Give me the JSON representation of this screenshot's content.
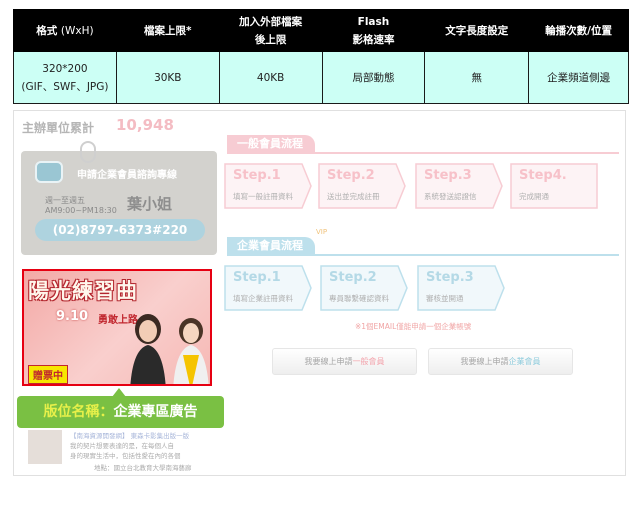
{
  "table": {
    "headers": [
      {
        "main": "格式",
        "sub": "(WxH)"
      },
      {
        "main": "檔案上限*",
        "sub": ""
      },
      {
        "main": "加入外部檔案",
        "main2": "後上限"
      },
      {
        "main": "Flash",
        "main2": "影格速率"
      },
      {
        "main": "文字長度設定",
        "sub": ""
      },
      {
        "main": "輪播次數/位置",
        "sub": ""
      }
    ],
    "row": {
      "format_size": "320*200",
      "format_types": "(GIF、SWF、JPG)",
      "file_limit": "30KB",
      "external_limit": "40KB",
      "flash_rate": "局部動態",
      "text_length": "無",
      "rotation": "企業頻道側邊"
    }
  },
  "preview": {
    "stat_label": "主辦單位累計",
    "stat_value": "10,948",
    "contact": {
      "title": "申請企業會員諮詢專線",
      "hours1": "週一至週五",
      "hours2": "AM9:00~PM18:30",
      "name": "葉小姐",
      "phone": "(02)8797-6373#220"
    },
    "ad": {
      "title": "陽光練習曲",
      "date": "9.10",
      "date_sub": "勇敢上路",
      "badge": "贈票中"
    },
    "placement_label": {
      "key": "版位名稱：",
      "value": "企業專區廣告"
    },
    "news": {
      "line1": "【南海資源開發網】 東森卡影集出版一版",
      "line2": "我的契片想要表達的是，在每個人自",
      "line3": "身的現實生活中，包括性愛在內的各個",
      "line4": "地點：國立台北教育大學南海藝廊"
    },
    "general_flow": {
      "heading": "一般會員流程",
      "steps": [
        {
          "title": "Step.1",
          "desc": "填寫一般註冊資料"
        },
        {
          "title": "Step.2",
          "desc": "送出並完成註冊"
        },
        {
          "title": "Step.3",
          "desc": "系統發送認證信"
        },
        {
          "title": "Step4.",
          "desc": "完成開通"
        }
      ]
    },
    "vip_label": "VIP",
    "enterprise_flow": {
      "heading": "企業會員流程",
      "steps": [
        {
          "title": "Step.1",
          "desc": "填寫企業註冊資料"
        },
        {
          "title": "Step.2",
          "desc": "專員聯繫確認資料"
        },
        {
          "title": "Step.3",
          "desc": "審核並開通"
        }
      ]
    },
    "note": "※1個EMAIL僅能申請一個企業帳號",
    "buttons": {
      "general_prefix": "我要線上申請",
      "general_suffix": "一般會員",
      "enterprise_prefix": "我要線上申請",
      "enterprise_suffix": "企業會員"
    }
  },
  "colors": {
    "table_header_bg": "#000000",
    "table_cell_bg": "#ccfff5",
    "ad_border": "#e60012",
    "label_bg": "#7ac043",
    "general_accent": "#f7ccd3",
    "enterprise_accent": "#bde0ec"
  }
}
